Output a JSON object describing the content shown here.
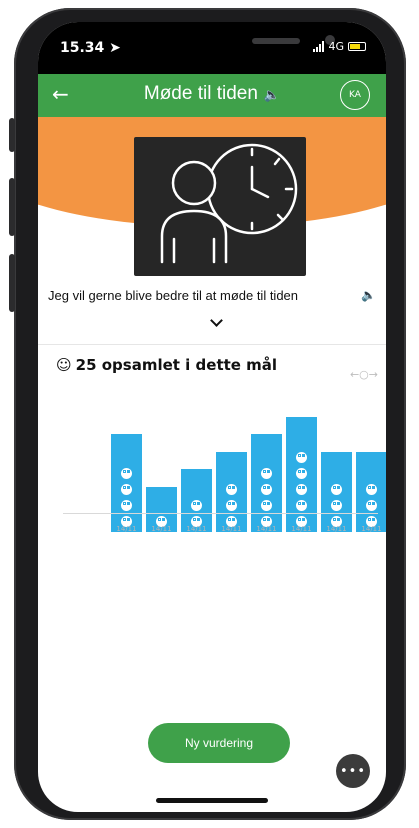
{
  "status_bar": {
    "time": "15.34",
    "location_icon": "location-arrow-icon",
    "network": "4G"
  },
  "app_bar": {
    "back_icon": "back-arrow-icon",
    "title": "Møde til tiden",
    "sound_icon": "speaker-icon",
    "avatar_initials": "KA"
  },
  "goal": {
    "image_icon": "person-clock-icon",
    "text": "Jeg vil gerne blive bedre til at møde til tiden",
    "sound_icon": "speaker-icon",
    "expand_icon": "chevron-down-icon"
  },
  "collected": {
    "icon": "smiley-icon",
    "text": "25 opsamlet i dette mål",
    "scroll_hint": "←○→"
  },
  "chart_data": {
    "type": "bar",
    "categories": [
      "14/11",
      "14/11",
      "14/11",
      "14/11",
      "14/11",
      "14/11",
      "14/11",
      "14/11"
    ],
    "values": [
      4,
      1,
      2,
      3,
      4,
      5,
      3,
      3
    ],
    "bar_color": "#2eaee6"
  },
  "actions": {
    "new_rating": "Ny vurdering",
    "more_icon": "more-dots-icon"
  },
  "colors": {
    "green": "#3fa14a",
    "orange": "#f39543",
    "blue": "#2eaee6"
  }
}
